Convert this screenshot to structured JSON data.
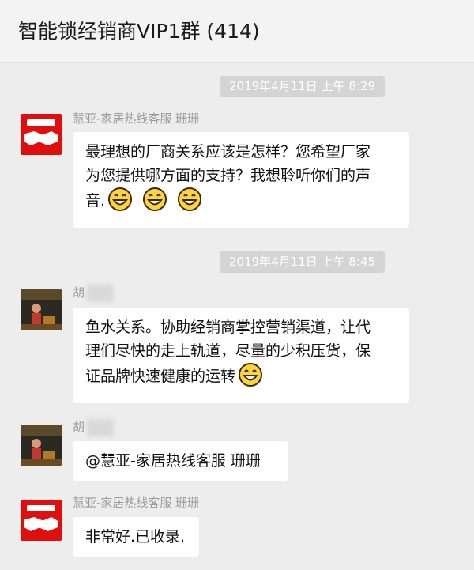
{
  "chat": {
    "title": "智能锁经销商VIP1群 (414)"
  },
  "timestamps": [
    "2019年4月11日 上午 8:29",
    "2019年4月11日 上午 8:45"
  ],
  "messages": [
    {
      "sender": "慧亚-家居热线客服 珊珊",
      "lines": [
        "最理想的厂商关系应该是怎样？您希望厂家",
        "为您提供哪方面的支持？我想聆听你们的声",
        "音."
      ],
      "emojis": [
        "grin-emoji",
        "grin-emoji",
        "grin-emoji"
      ]
    },
    {
      "sender": "胡",
      "lines": [
        "鱼水关系。协助经销商掌控营销渠道，让代",
        "理们尽快的走上轨道，尽量的少积压货，保",
        "证品牌快速健康的运转"
      ],
      "emojis": [
        "grin-emoji"
      ]
    },
    {
      "sender": "胡",
      "lines": [
        "@慧亚-家居热线客服 珊珊"
      ]
    },
    {
      "sender": "慧亚-家居热线客服 珊珊",
      "lines": [
        "非常好.已收录."
      ]
    }
  ],
  "colors": {
    "background": "#ededed",
    "bubble": "#ffffff",
    "timestamp_chip": "#d4d4d4",
    "brand_red": "#e10e0e"
  }
}
